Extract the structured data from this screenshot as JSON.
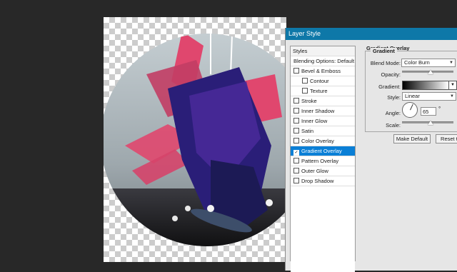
{
  "dialog": {
    "title": "Layer Style",
    "styles_header": "Styles",
    "style_items": [
      {
        "label": "Blending Options: Default",
        "checkbox": false,
        "indent": false,
        "selected": false,
        "checked": false
      },
      {
        "label": "Bevel & Emboss",
        "checkbox": true,
        "indent": false,
        "selected": false,
        "checked": false
      },
      {
        "label": "Contour",
        "checkbox": true,
        "indent": true,
        "selected": false,
        "checked": false
      },
      {
        "label": "Texture",
        "checkbox": true,
        "indent": true,
        "selected": false,
        "checked": false
      },
      {
        "label": "Stroke",
        "checkbox": true,
        "indent": false,
        "selected": false,
        "checked": false
      },
      {
        "label": "Inner Shadow",
        "checkbox": true,
        "indent": false,
        "selected": false,
        "checked": false
      },
      {
        "label": "Inner Glow",
        "checkbox": true,
        "indent": false,
        "selected": false,
        "checked": false
      },
      {
        "label": "Satin",
        "checkbox": true,
        "indent": false,
        "selected": false,
        "checked": false
      },
      {
        "label": "Color Overlay",
        "checkbox": true,
        "indent": false,
        "selected": false,
        "checked": false
      },
      {
        "label": "Gradient Overlay",
        "checkbox": true,
        "indent": false,
        "selected": true,
        "checked": true
      },
      {
        "label": "Pattern Overlay",
        "checkbox": true,
        "indent": false,
        "selected": false,
        "checked": false
      },
      {
        "label": "Outer Glow",
        "checkbox": true,
        "indent": false,
        "selected": false,
        "checked": false
      },
      {
        "label": "Drop Shadow",
        "checkbox": true,
        "indent": false,
        "selected": false,
        "checked": false
      }
    ],
    "panel": {
      "section_title": "Gradient Overlay",
      "group_title": "Gradient",
      "blend_mode_label": "Blend Mode:",
      "blend_mode_value": "Color Burn",
      "opacity_label": "Opacity:",
      "opacity_value": 0.55,
      "gradient_label": "Gradient:",
      "style_label": "Style:",
      "style_value": "Linear",
      "angle_label": "Angle:",
      "angle_value": "65",
      "angle_degrees": 65,
      "angle_unit": "°",
      "scale_label": "Scale:",
      "scale_value": 0.55,
      "make_default_label": "Make Default",
      "reset_label": "Reset to"
    }
  },
  "colors": {
    "workspace_bg": "#282828",
    "titlebar": "#0e78a8",
    "selection": "#0a7fd6",
    "overlay_magenta": "#e0476e",
    "overlay_indigo": "#2a1e78"
  },
  "icons": {
    "checkbox_checked": "check-mark-icon",
    "dropdown": "chevron-down-icon"
  }
}
